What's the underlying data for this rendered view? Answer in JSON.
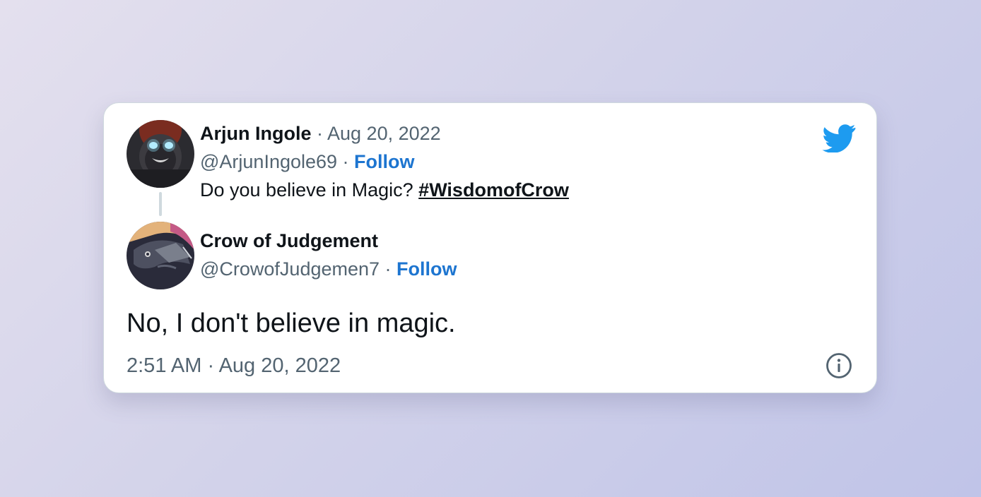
{
  "brand": {
    "accent": "#1d9bf0",
    "link_color": "#1d75d0",
    "icon": "twitter-bird-icon"
  },
  "original_tweet": {
    "author_name": "Arjun Ingole",
    "separator": " · ",
    "date": "Aug 20, 2022",
    "handle": "@ArjunIngole69",
    "follow_label": "Follow",
    "text": "Do you believe in Magic? ",
    "hashtag": "#WisdomofCrow"
  },
  "reply_tweet": {
    "author_name": "Crow of Judgement",
    "handle": "@CrowofJudgemen7",
    "follow_label": "Follow",
    "text": "No, I don't believe in magic."
  },
  "footer": {
    "timestamp": "2:51 AM · Aug 20, 2022",
    "info_icon": "info-icon"
  }
}
